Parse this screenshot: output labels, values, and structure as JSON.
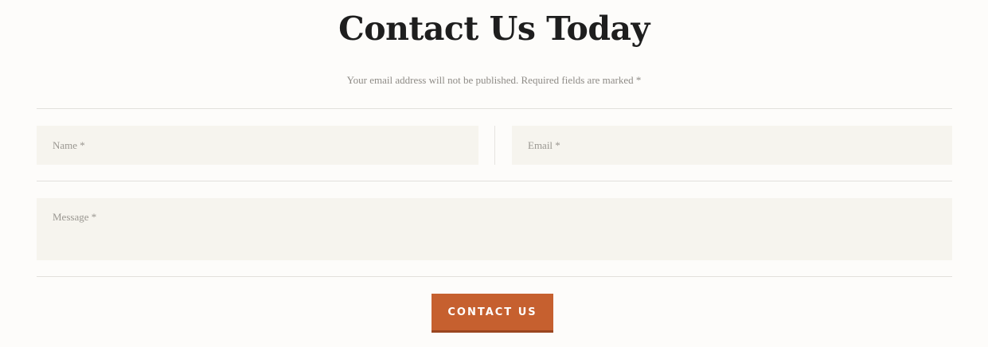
{
  "form": {
    "title": "Contact Us Today",
    "notice": "Your email address will not be published. Required fields are marked *",
    "name_placeholder": "Name *",
    "email_placeholder": "Email *",
    "message_placeholder": "Message *",
    "submit_label": "Contact Us"
  },
  "colors": {
    "background": "#fdfcfa",
    "field_background": "#f6f4ee",
    "button": "#c6602f",
    "title": "#1e1e1e"
  }
}
